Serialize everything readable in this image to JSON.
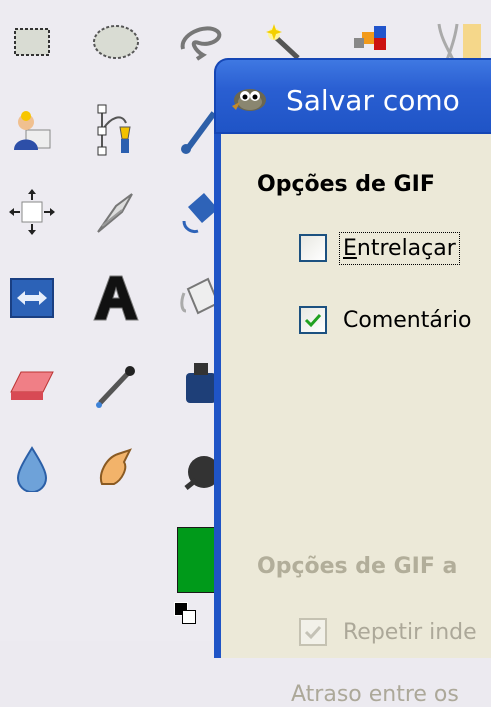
{
  "toolbox": {
    "tools": [
      {
        "icon": "rect-select-icon"
      },
      {
        "icon": "ellipse-select-icon"
      },
      {
        "icon": "free-select-icon"
      },
      {
        "icon": "fuzzy-select-icon"
      },
      {
        "icon": "color-select-icon"
      },
      {
        "icon": "scissors-select-icon"
      },
      {
        "icon": "foreground-select-icon"
      },
      {
        "icon": "paths-icon"
      },
      {
        "icon": "color-picker-icon"
      },
      {
        "icon": "move-icon"
      },
      {
        "icon": "crop-icon"
      },
      {
        "icon": "rotate-icon"
      },
      {
        "icon": "flip-icon"
      },
      {
        "icon": "text-icon"
      },
      {
        "icon": "bucket-fill-icon"
      },
      {
        "icon": "eraser-icon"
      },
      {
        "icon": "airbrush-icon"
      },
      {
        "icon": "ink-icon"
      },
      {
        "icon": "blur-icon"
      },
      {
        "icon": "smudge-icon"
      },
      {
        "icon": "dodge-burn-icon"
      }
    ],
    "foreground_color": "#009a1a",
    "background_color": "#ffffff"
  },
  "dialog": {
    "title": "Salvar como",
    "sections": [
      {
        "title": "Opções de GIF",
        "options": [
          {
            "label_mnemonic": "E",
            "label_rest": "ntrelaçar",
            "checked": false
          },
          {
            "label": "Comentário",
            "checked": true
          }
        ]
      },
      {
        "title": "Opções de GIF a",
        "disabled": true,
        "options": [
          {
            "label": "Repetir inde",
            "checked": true,
            "disabled": true
          }
        ]
      }
    ],
    "partial_text": "Atraso entre os"
  }
}
